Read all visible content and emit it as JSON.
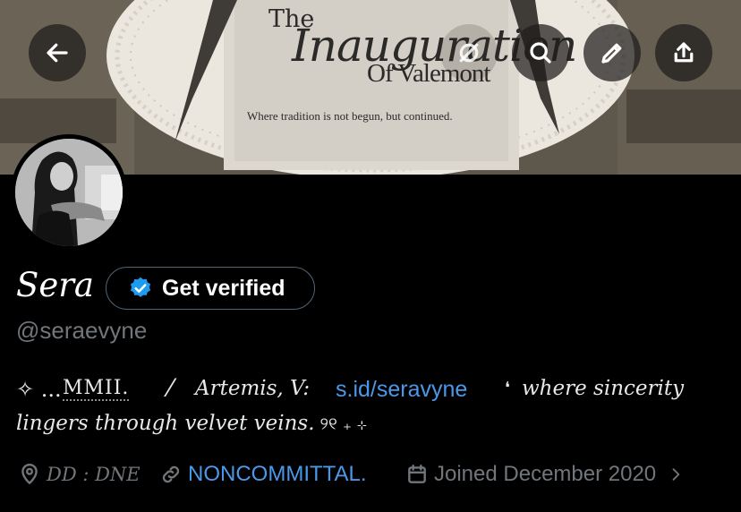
{
  "banner": {
    "title_line1": "The",
    "title_line2": "Inauguration",
    "title_line3": "Of Valemont",
    "tagline": "Where tradition is not begun, but continued."
  },
  "toolbar": {
    "back_icon": "arrow-left-icon",
    "grok_icon": "grok-icon",
    "search_icon": "search-icon",
    "edit_icon": "pencil-icon",
    "share_icon": "share-icon"
  },
  "profile": {
    "display_name": "Sera",
    "verify_label": "Get verified",
    "handle": "@seraevyne",
    "bio": {
      "prefix": "✧ ...",
      "mmii": "MMII.",
      "slash": "⁄",
      "name_part": "Artemis, V:",
      "link": "s.id/seravyne",
      "quote_mark": "❛",
      "line1_tail": "where sincerity",
      "line2": "lingers through velvet veins.",
      "line2_tail": "୨୧ ₊ ⊹"
    },
    "location": "DD : DNE",
    "website": "NONCOMMITTAL.",
    "joined": "Joined December 2020"
  },
  "colors": {
    "background": "#000000",
    "accent_link": "#4a99e9",
    "verified_badge": "#1d9bf0",
    "muted_text": "#71767b"
  }
}
